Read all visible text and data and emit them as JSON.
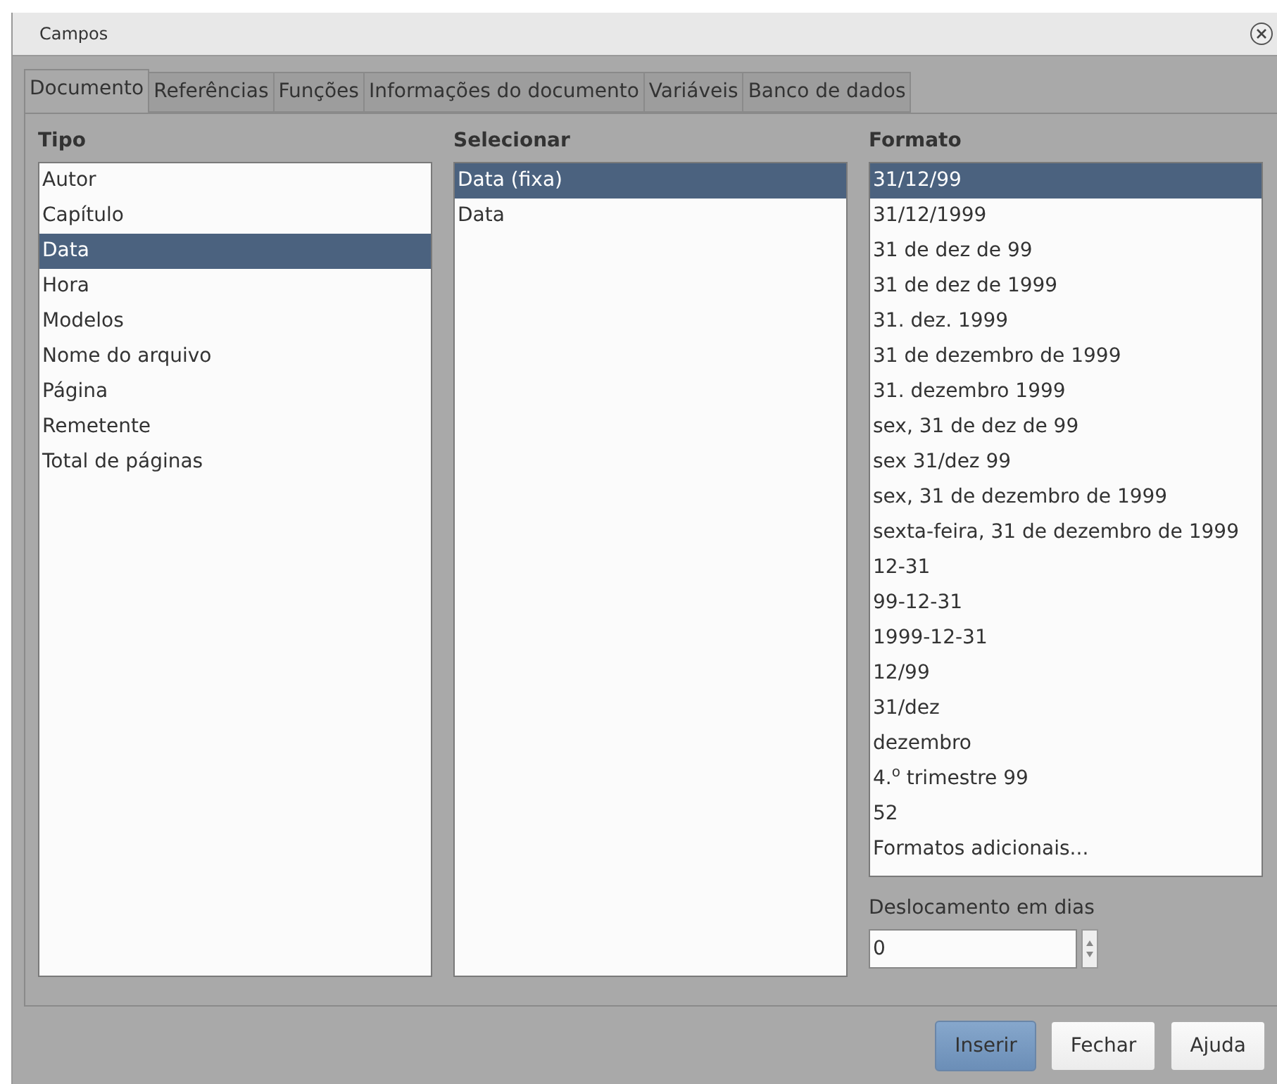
{
  "window": {
    "title": "Campos"
  },
  "tabs": [
    {
      "label": "Documento",
      "selected": true
    },
    {
      "label": "Referências",
      "selected": false
    },
    {
      "label": "Funções",
      "selected": false
    },
    {
      "label": "Informações do documento",
      "selected": false
    },
    {
      "label": "Variáveis",
      "selected": false
    },
    {
      "label": "Banco de dados",
      "selected": false
    }
  ],
  "type_list": {
    "label": "Tipo",
    "items": [
      {
        "label": "Autor",
        "selected": false
      },
      {
        "label": "Capítulo",
        "selected": false
      },
      {
        "label": "Data",
        "selected": true
      },
      {
        "label": "Hora",
        "selected": false
      },
      {
        "label": "Modelos",
        "selected": false
      },
      {
        "label": "Nome do arquivo",
        "selected": false
      },
      {
        "label": "Página",
        "selected": false
      },
      {
        "label": "Remetente",
        "selected": false
      },
      {
        "label": "Total de páginas",
        "selected": false
      }
    ]
  },
  "select_list": {
    "label": "Selecionar",
    "items": [
      {
        "label": "Data (fixa)",
        "selected": true
      },
      {
        "label": "Data",
        "selected": false
      }
    ]
  },
  "format_list": {
    "label": "Formato",
    "items": [
      {
        "label": "31/12/99",
        "selected": true
      },
      {
        "label": "31/12/1999",
        "selected": false
      },
      {
        "label": "31 de dez de 99",
        "selected": false
      },
      {
        "label": "31 de dez de 1999",
        "selected": false
      },
      {
        "label": "31. dez. 1999",
        "selected": false
      },
      {
        "label": "31 de dezembro de 1999",
        "selected": false
      },
      {
        "label": "31. dezembro 1999",
        "selected": false
      },
      {
        "label": "sex, 31 de dez de 99",
        "selected": false
      },
      {
        "label": "sex 31/dez 99",
        "selected": false
      },
      {
        "label": "sex, 31 de dezembro de 1999",
        "selected": false
      },
      {
        "label": "sexta-feira, 31 de dezembro de 1999",
        "selected": false
      },
      {
        "label": "12-31",
        "selected": false
      },
      {
        "label": "99-12-31",
        "selected": false
      },
      {
        "label": "1999-12-31",
        "selected": false
      },
      {
        "label": "12/99",
        "selected": false
      },
      {
        "label": "31/dez",
        "selected": false
      },
      {
        "label": "dezembro",
        "selected": false
      },
      {
        "label": "4.$^{o}$ trimestre 99",
        "selected": false
      },
      {
        "label": "52",
        "selected": false
      },
      {
        "label": "Formatos adicionais...",
        "selected": false
      }
    ]
  },
  "offset": {
    "label": "Deslocamento em dias",
    "value": "0"
  },
  "buttons": [
    {
      "label": "Inserir",
      "default": true
    },
    {
      "label": "Fechar",
      "default": false
    },
    {
      "label": "Ajuda",
      "default": false
    }
  ]
}
